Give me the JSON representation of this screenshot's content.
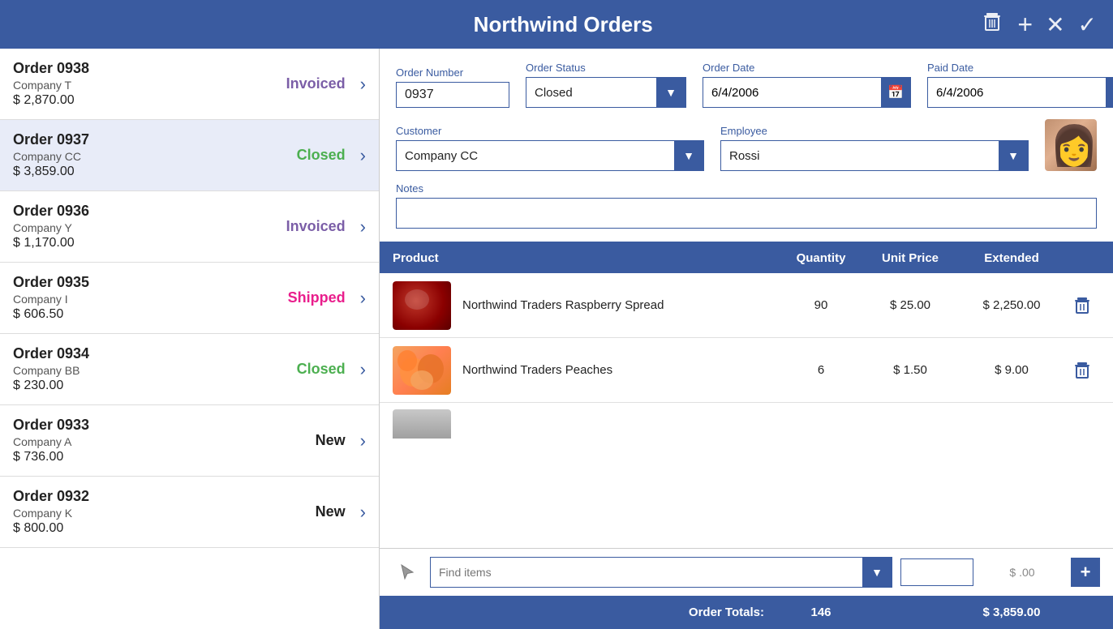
{
  "app": {
    "title": "Northwind Orders"
  },
  "header": {
    "delete_label": "🗑",
    "add_label": "+",
    "cancel_label": "✕",
    "confirm_label": "✓"
  },
  "order_list": {
    "orders": [
      {
        "id": "order-0938",
        "number": "Order 0938",
        "company": "Company T",
        "amount": "$ 2,870.00",
        "status": "Invoiced",
        "status_class": "status-invoiced"
      },
      {
        "id": "order-0937",
        "number": "Order 0937",
        "company": "Company CC",
        "amount": "$ 3,859.00",
        "status": "Closed",
        "status_class": "status-closed",
        "selected": true
      },
      {
        "id": "order-0936",
        "number": "Order 0936",
        "company": "Company Y",
        "amount": "$ 1,170.00",
        "status": "Invoiced",
        "status_class": "status-invoiced"
      },
      {
        "id": "order-0935",
        "number": "Order 0935",
        "company": "Company I",
        "amount": "$ 606.50",
        "status": "Shipped",
        "status_class": "status-shipped"
      },
      {
        "id": "order-0934",
        "number": "Order 0934",
        "company": "Company BB",
        "amount": "$ 230.00",
        "status": "Closed",
        "status_class": "status-closed"
      },
      {
        "id": "order-0933",
        "number": "Order 0933",
        "company": "Company A",
        "amount": "$ 736.00",
        "status": "New",
        "status_class": "status-new"
      },
      {
        "id": "order-0932",
        "number": "Order 0932",
        "company": "Company K",
        "amount": "$ 800.00",
        "status": "New",
        "status_class": "status-new"
      }
    ]
  },
  "detail": {
    "fields": {
      "order_number_label": "Order Number",
      "order_number_value": "0937",
      "order_status_label": "Order Status",
      "order_status_value": "Closed",
      "order_date_label": "Order Date",
      "order_date_value": "6/4/2006",
      "paid_date_label": "Paid Date",
      "paid_date_value": "6/4/2006",
      "customer_label": "Customer",
      "customer_value": "Company CC",
      "employee_label": "Employee",
      "employee_value": "Rossi",
      "notes_label": "Notes",
      "notes_value": ""
    },
    "table": {
      "col_product": "Product",
      "col_quantity": "Quantity",
      "col_unit_price": "Unit Price",
      "col_extended": "Extended"
    },
    "products": [
      {
        "name": "Northwind Traders Raspberry Spread",
        "quantity": "90",
        "unit_price": "$ 25.00",
        "extended": "$ 2,250.00",
        "image_type": "raspberry"
      },
      {
        "name": "Northwind Traders Peaches",
        "quantity": "6",
        "unit_price": "$ 1.50",
        "extended": "$ 9.00",
        "image_type": "peaches"
      }
    ],
    "add_row": {
      "find_placeholder": "Find items",
      "qty_value": "",
      "price_display": "$ .00"
    },
    "totals": {
      "label": "Order Totals:",
      "quantity": "146",
      "amount": "$ 3,859.00"
    },
    "status_options": [
      "New",
      "Shipped",
      "Invoiced",
      "Closed"
    ]
  }
}
